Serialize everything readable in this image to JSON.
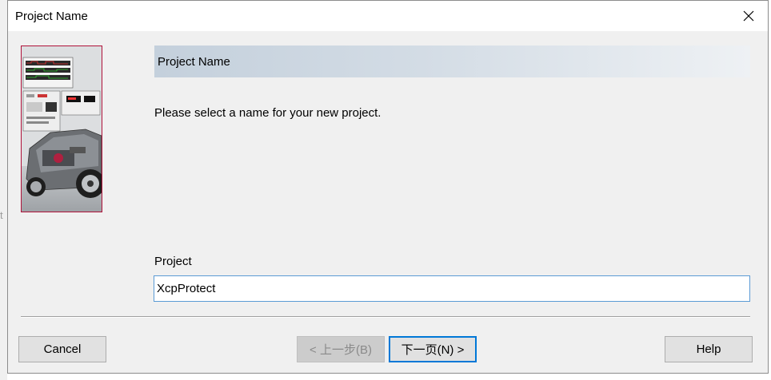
{
  "background": {
    "partial_char": "t"
  },
  "window": {
    "title": "Project Name",
    "close_glyph": "×"
  },
  "header": {
    "title": "Project Name"
  },
  "main": {
    "instruction": "Please select a name for your new project.",
    "project_label": "Project",
    "project_value": "XcpProtect"
  },
  "buttons": {
    "cancel": "Cancel",
    "back": "< 上一步(B)",
    "next": "下一页(N) >",
    "help": "Help"
  },
  "colors": {
    "accent": "#0078d7",
    "input_border": "#5b9bd5",
    "image_border": "#b0123a"
  }
}
